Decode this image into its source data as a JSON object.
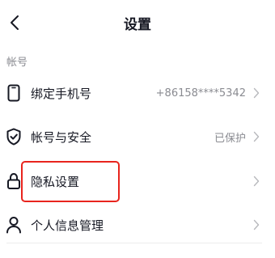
{
  "header": {
    "title": "设置"
  },
  "section": {
    "title": "帐号"
  },
  "rows": [
    {
      "label": "绑定手机号",
      "value": "+86158****5342",
      "icon": "phone-icon"
    },
    {
      "label": "帐号与安全",
      "value": "已保护",
      "icon": "shield-check-icon"
    },
    {
      "label": "隐私设置",
      "value": "",
      "icon": "lock-icon"
    },
    {
      "label": "个人信息管理",
      "value": "",
      "icon": "person-icon"
    }
  ],
  "colors": {
    "text_primary": "#161823",
    "text_secondary": "#8a8b91",
    "highlight": "#e8241d"
  }
}
